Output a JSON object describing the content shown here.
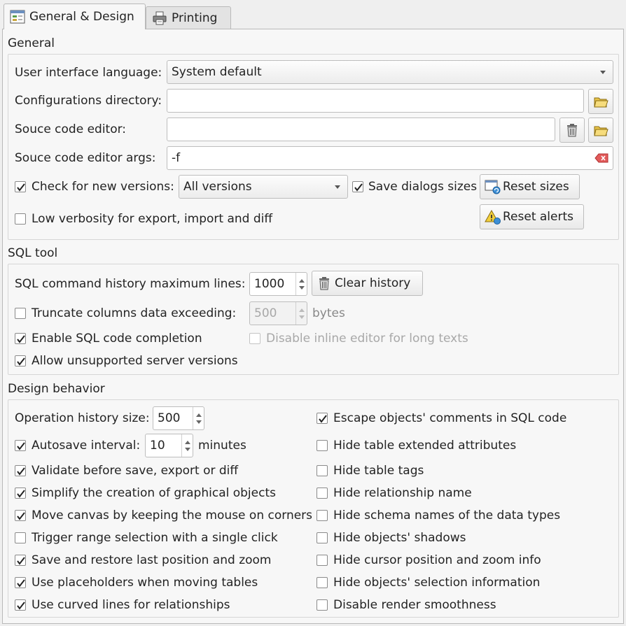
{
  "tabs": [
    {
      "label": "General & Design",
      "icon": "settings-icon"
    },
    {
      "label": "Printing",
      "icon": "printer-icon"
    }
  ],
  "general": {
    "title": "General",
    "ui_language_label": "User interface language:",
    "ui_language_value": "System default",
    "config_dir_label": "Configurations directory:",
    "config_dir_value": "",
    "source_editor_label": "Souce code editor:",
    "source_editor_value": "",
    "source_editor_args_label": "Souce code editor args:",
    "source_editor_args_value": "-f",
    "check_versions_label": "Check for new versions:",
    "check_versions_checked": true,
    "versions_value": "All versions",
    "save_dialog_sizes_label": "Save dialogs sizes",
    "save_dialog_sizes_checked": true,
    "reset_sizes_label": "Reset sizes",
    "low_verbosity_label": "Low verbosity for export, import and diff",
    "low_verbosity_checked": false,
    "reset_alerts_label": "Reset alerts"
  },
  "sql_tool": {
    "title": "SQL tool",
    "history_max_label": "SQL command history maximum lines:",
    "history_max_value": "1000",
    "clear_history_label": "Clear history",
    "truncate_label": "Truncate columns data exceeding:",
    "truncate_checked": false,
    "truncate_value": "500",
    "truncate_unit": "bytes",
    "code_completion_label": "Enable SQL code completion",
    "code_completion_checked": true,
    "disable_inline_label": "Disable inline editor for long texts",
    "disable_inline_checked": false,
    "unsupported_label": "Allow unsupported server versions",
    "unsupported_checked": true
  },
  "design": {
    "title": "Design behavior",
    "op_history_label": "Operation history size:",
    "op_history_value": "500",
    "autosave_label": "Autosave interval:",
    "autosave_checked": true,
    "autosave_value": "10",
    "autosave_unit": "minutes",
    "left_checks": [
      {
        "label": "Validate before save, export or diff",
        "checked": true
      },
      {
        "label": "Simplify the creation of graphical objects",
        "checked": true
      },
      {
        "label": "Move canvas by keeping the mouse on corners",
        "checked": true
      },
      {
        "label": "Trigger range selection with a single click",
        "checked": false
      },
      {
        "label": "Save and restore last position and zoom",
        "checked": true
      },
      {
        "label": "Use placeholders when moving tables",
        "checked": true
      },
      {
        "label": "Use curved lines for relationships",
        "checked": true
      }
    ],
    "right_checks": [
      {
        "label": "Escape objects' comments in SQL code",
        "checked": true
      },
      {
        "label": "Hide table extended attributes",
        "checked": false
      },
      {
        "label": "Hide table tags",
        "checked": false
      },
      {
        "label": "Hide relationship name",
        "checked": false
      },
      {
        "label": "Hide schema names of the data types",
        "checked": false
      },
      {
        "label": "Hide objects' shadows",
        "checked": false
      },
      {
        "label": "Hide cursor position and zoom info",
        "checked": false
      },
      {
        "label": "Hide objects' selection information",
        "checked": false
      },
      {
        "label": "Disable render smoothness",
        "checked": false
      }
    ]
  }
}
